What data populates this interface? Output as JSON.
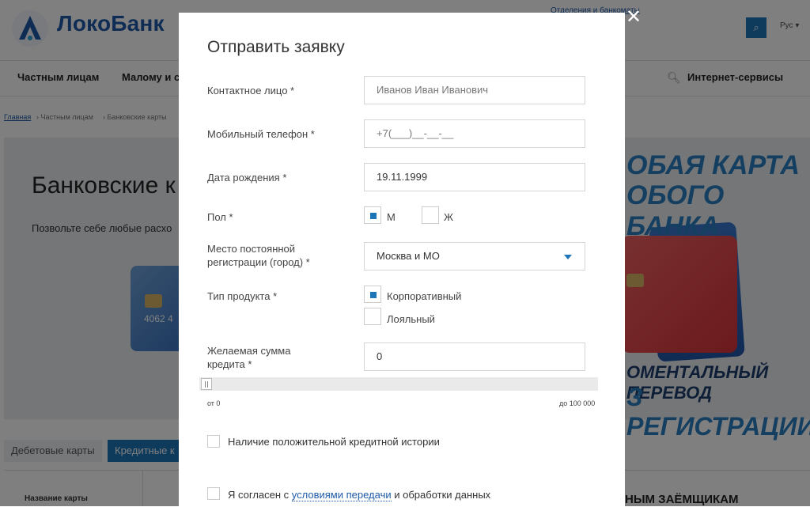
{
  "site": {
    "logo_text": "ЛокоБанк",
    "top_link": "Отделения и банкоматы",
    "lang": "Рус",
    "nav": [
      "Частным лицам",
      "Малому и с"
    ],
    "internet_services": "Интернет-сервисы",
    "breadcrumbs": [
      "Главная",
      "Частным лицам",
      "Банковские карты"
    ],
    "hero_title": "Банковские к",
    "hero_subtitle": "Позвольте себе любые расхо",
    "card_number": "4062  4",
    "banner_lines": [
      "ОБАЯ КАРТА",
      "ОБОГО БАНКА",
      "ОМЕНТАЛЬНЫЙ ПЕРЕВОД",
      "З РЕГИСТРАЦИИ"
    ],
    "tabs": [
      "Дебетовые карты",
      "Кредитные к"
    ],
    "table_header": "Название карты",
    "table_right": "НЫМ ЗАЁМЩИКАМ"
  },
  "modal": {
    "close": "✕",
    "title": "Отправить заявку",
    "contact_label": "Контактное лицо *",
    "contact_placeholder": "Иванов Иван Иванович",
    "phone_label": "Мобильный телефон *",
    "phone_placeholder": "+7(___)__-__-__",
    "birth_label": "Дата рождения *",
    "birth_value": "19.11.1999",
    "gender_label": "Пол *",
    "gender_options": [
      {
        "label": "М",
        "checked": true
      },
      {
        "label": "Ж",
        "checked": false
      }
    ],
    "reg_label_1": "Место постоянной",
    "reg_label_2": "регистрации (город) *",
    "reg_value": "Москва и МО",
    "product_label": "Тип продукта *",
    "product_options": [
      {
        "label": "Корпоративный",
        "checked": true
      },
      {
        "label": "Лояльный",
        "checked": false
      }
    ],
    "amount_label_1": "Желаемая сумма",
    "amount_label_2": "кредита *",
    "amount_value": "0",
    "slider_min": "от 0",
    "slider_max": "до 100 000",
    "slider_fraction": 0,
    "credit_history_label": "Наличие положительной кредитной истории",
    "consent_prefix": "Я согласен с ",
    "consent_link": "условиями передачи",
    "consent_suffix": " и обработки данных"
  }
}
